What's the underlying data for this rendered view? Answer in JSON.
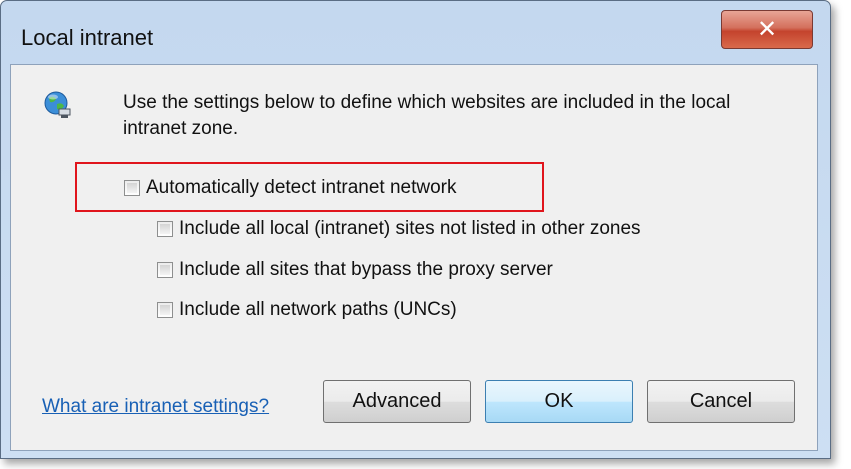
{
  "window": {
    "title": "Local intranet",
    "close_glyph": "✕"
  },
  "content": {
    "intro": "Use the settings below to define which websites are included in the local intranet zone.",
    "icon": "globe-network-icon"
  },
  "checkboxes": [
    {
      "label": "Automatically detect intranet network",
      "checked": false
    },
    {
      "label": "Include all local (intranet) sites not listed in other zones",
      "checked": false
    },
    {
      "label": "Include all sites that bypass the proxy server",
      "checked": false
    },
    {
      "label": "Include all network paths (UNCs)",
      "checked": false
    }
  ],
  "footer": {
    "help_link": "What are intranet settings?",
    "advanced": "Advanced",
    "ok": "OK",
    "cancel": "Cancel"
  },
  "colors": {
    "highlight": "#e0151c",
    "link": "#1860b5"
  }
}
